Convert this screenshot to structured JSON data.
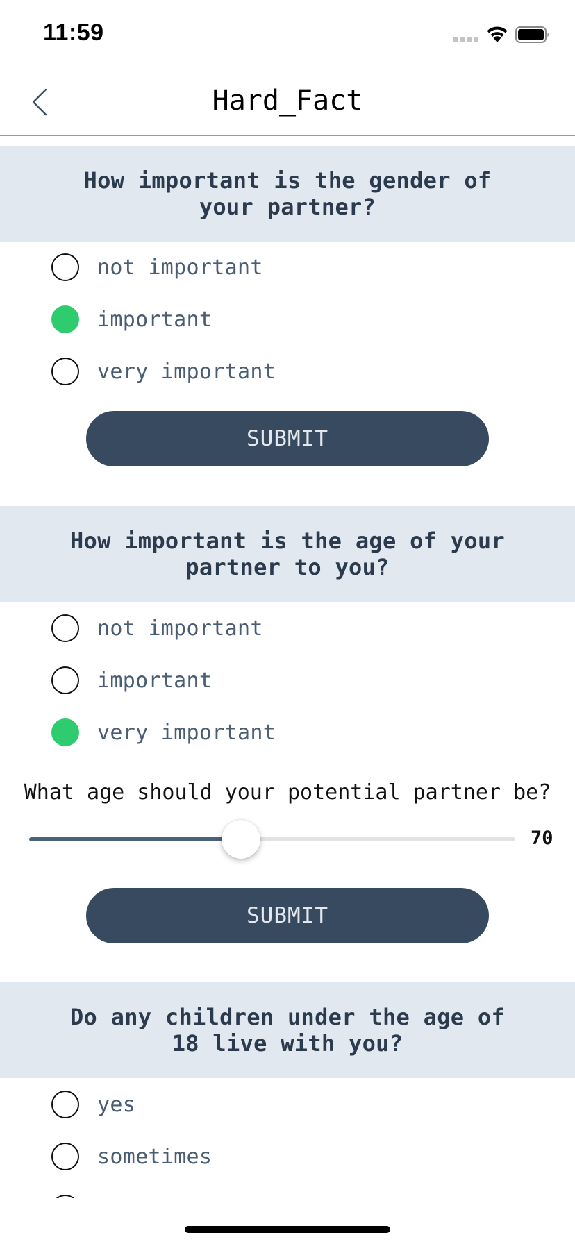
{
  "status_bar": {
    "time": "11:59"
  },
  "nav": {
    "title": "Hard_Fact",
    "back_icon": "chevron-left-icon"
  },
  "questions": [
    {
      "text": "How important is the gender of your partner?",
      "options": [
        "not important",
        "important",
        "very important"
      ],
      "selected": "important",
      "submit_label": "SUBMIT"
    },
    {
      "text": "How important is the age of your partner to you?",
      "options": [
        "not important",
        "important",
        "very important"
      ],
      "selected": "very important",
      "slider": {
        "label": "What age should your potential partner be?",
        "value": "70",
        "fraction": 0.435
      },
      "submit_label": "SUBMIT"
    },
    {
      "text": "Do any children under the age of 18 live with you?",
      "options": [
        "yes",
        "sometimes"
      ],
      "selected": null
    }
  ],
  "colors": {
    "selected_radio": "#2ecc6f",
    "button": "#374a5f",
    "question_bg": "#e2e8ef",
    "slider_fill": "#4a6278"
  }
}
